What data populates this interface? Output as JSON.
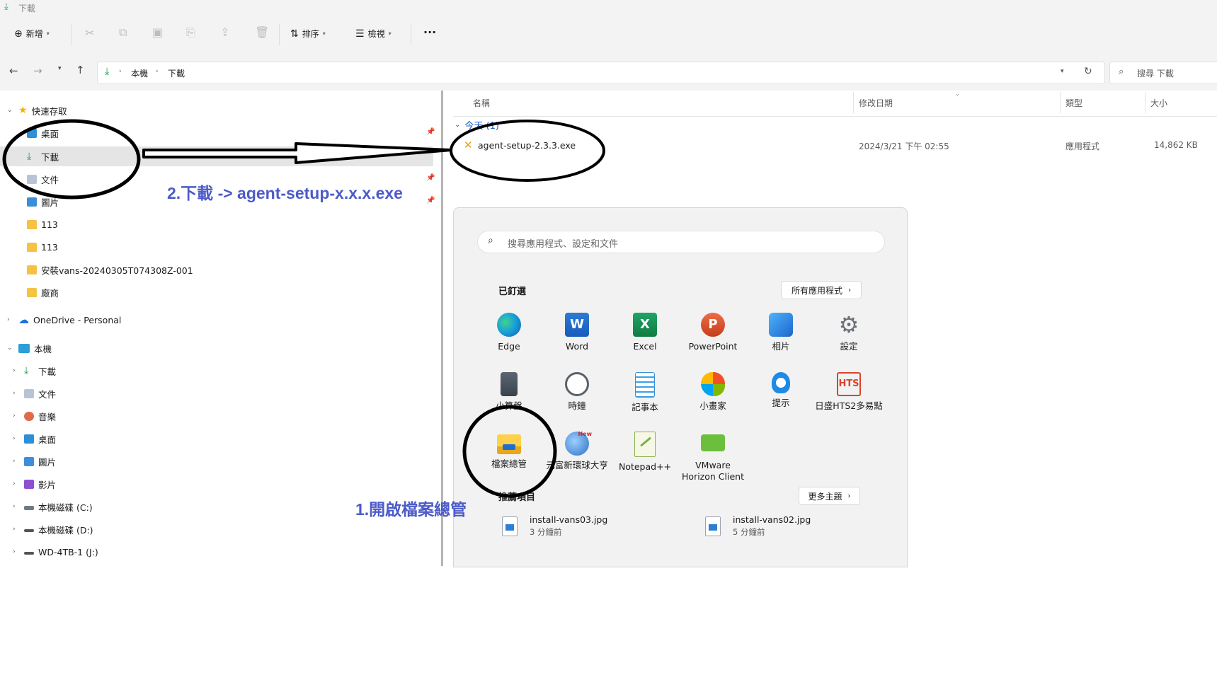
{
  "window": {
    "title": "下載"
  },
  "commandbar": {
    "new_label": "新增",
    "sort_label": "排序",
    "view_label": "檢視",
    "more_label": "···"
  },
  "address": {
    "segments": [
      "本機",
      "下載"
    ],
    "search_placeholder": "搜尋 下載"
  },
  "sidebar": {
    "quick_access": {
      "label": "快速存取",
      "items": [
        {
          "label": "桌面",
          "icon": "desktop-icon"
        },
        {
          "label": "下載",
          "icon": "download-icon"
        },
        {
          "label": "文件",
          "icon": "document-icon"
        },
        {
          "label": "圖片",
          "icon": "pictures-icon"
        },
        {
          "label": "113",
          "icon": "folder-icon"
        },
        {
          "label": "113",
          "icon": "folder-icon"
        },
        {
          "label": "安裝vans-20240305T074308Z-001",
          "icon": "folder-icon"
        },
        {
          "label": "廠商",
          "icon": "folder-icon"
        }
      ]
    },
    "onedrive": {
      "label": "OneDrive - Personal"
    },
    "this_pc": {
      "label": "本機",
      "items": [
        {
          "label": "下載",
          "icon": "download-icon"
        },
        {
          "label": "文件",
          "icon": "document-icon"
        },
        {
          "label": "音樂",
          "icon": "music-icon"
        },
        {
          "label": "桌面",
          "icon": "desktop-icon"
        },
        {
          "label": "圖片",
          "icon": "pictures-icon"
        },
        {
          "label": "影片",
          "icon": "video-icon"
        },
        {
          "label": "本機磁碟 (C:)",
          "icon": "drive-icon"
        },
        {
          "label": "本機磁碟 (D:)",
          "icon": "drive-icon"
        },
        {
          "label": "WD-4TB-1 (J:)",
          "icon": "drive-icon"
        }
      ]
    }
  },
  "filelist": {
    "columns": {
      "name": "名稱",
      "modified": "修改日期",
      "type": "類型",
      "size": "大小"
    },
    "group": "今天 (1)",
    "files": [
      {
        "name": "agent-setup-2.3.3.exe",
        "modified": "2024/3/21 下午 02:55",
        "type": "應用程式",
        "size": "14,862 KB"
      }
    ]
  },
  "startmenu": {
    "search_placeholder": "搜尋應用程式、設定和文件",
    "pinned_label": "已釘選",
    "all_apps_label": "所有應用程式",
    "apps": [
      {
        "label": "Edge",
        "icon": "edge-icon"
      },
      {
        "label": "Word",
        "icon": "word-icon"
      },
      {
        "label": "Excel",
        "icon": "excel-icon"
      },
      {
        "label": "PowerPoint",
        "icon": "powerpoint-icon"
      },
      {
        "label": "相片",
        "icon": "photos-icon"
      },
      {
        "label": "設定",
        "icon": "settings-icon"
      },
      {
        "label": "小算盤",
        "icon": "calculator-icon"
      },
      {
        "label": "時鐘",
        "icon": "clock-icon"
      },
      {
        "label": "記事本",
        "icon": "notepad-icon"
      },
      {
        "label": "小畫家",
        "icon": "paint-icon"
      },
      {
        "label": "提示",
        "icon": "tips-icon"
      },
      {
        "label": "日盛HTS2多易點",
        "icon": "hts2-icon"
      },
      {
        "label": "檔案總管",
        "icon": "file-explorer-icon"
      },
      {
        "label": "元富新環球大亨",
        "icon": "masterlink-icon"
      },
      {
        "label": "Notepad++",
        "icon": "notepadpp-icon"
      },
      {
        "label": "VMware Horizon Client",
        "icon": "vmware-horizon-icon"
      }
    ],
    "recommended_label": "推薦項目",
    "more_label": "更多主題",
    "recommended": [
      {
        "name": "install-vans03.jpg",
        "time": "3 分鐘前"
      },
      {
        "name": "install-vans02.jpg",
        "time": "5 分鐘前"
      }
    ]
  },
  "annotations": {
    "step1": "1.開啟檔案總管",
    "step2": "2.下載 -> agent-setup-x.x.x.exe"
  },
  "colors": {
    "annotation": "#4c5bc8",
    "accent": "#0067c0",
    "folder": "#f5c244"
  }
}
